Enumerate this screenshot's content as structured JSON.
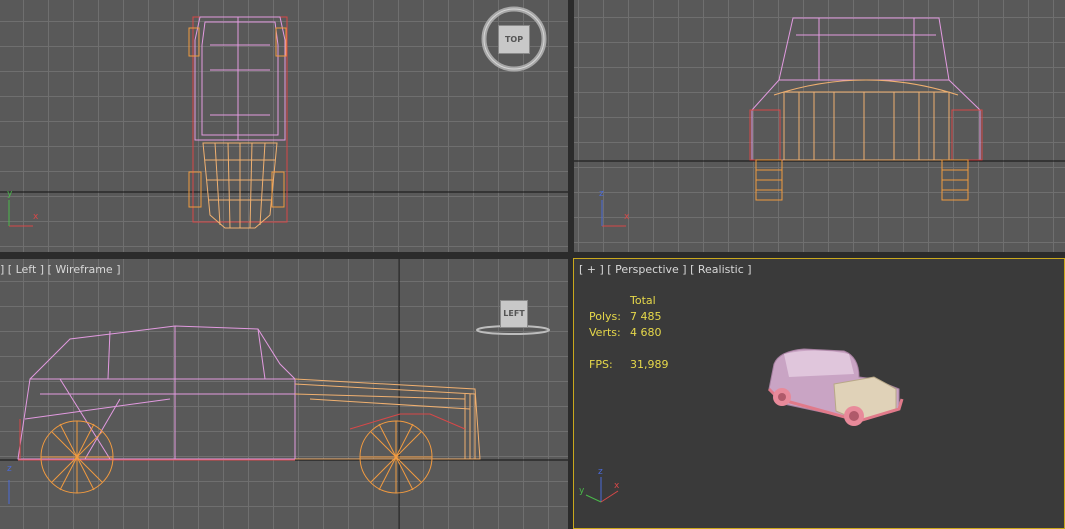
{
  "viewports": {
    "top": {
      "label": "",
      "viewcube_label": "TOP"
    },
    "front": {
      "label": ""
    },
    "left": {
      "label": "] [ Left ] [ Wireframe ]",
      "viewcube_label": "LEFT"
    },
    "perspective": {
      "label": "[ + ] [ Perspective ] [ Realistic ]",
      "stats": {
        "header": "Total",
        "polys_label": "Polys:",
        "polys_value": "7 485",
        "verts_label": "Verts:",
        "verts_value": "4 680",
        "fps_label": "FPS:",
        "fps_value": "31,989"
      }
    }
  },
  "axis_labels": {
    "x": "x",
    "y": "y",
    "z": "z"
  },
  "colors": {
    "grid": "#6f6f6f",
    "viewport_bg": "#595959",
    "active_border": "#c9a81d",
    "body_wire": "#e29ae0",
    "hood_wire": "#f0b070",
    "wheel_wire": "#f09a40",
    "red_wire": "#d84848",
    "stats_text": "#e6d84a"
  },
  "icons": [
    "viewcube-top-icon",
    "viewcube-left-icon",
    "axis-tripod-icon"
  ]
}
